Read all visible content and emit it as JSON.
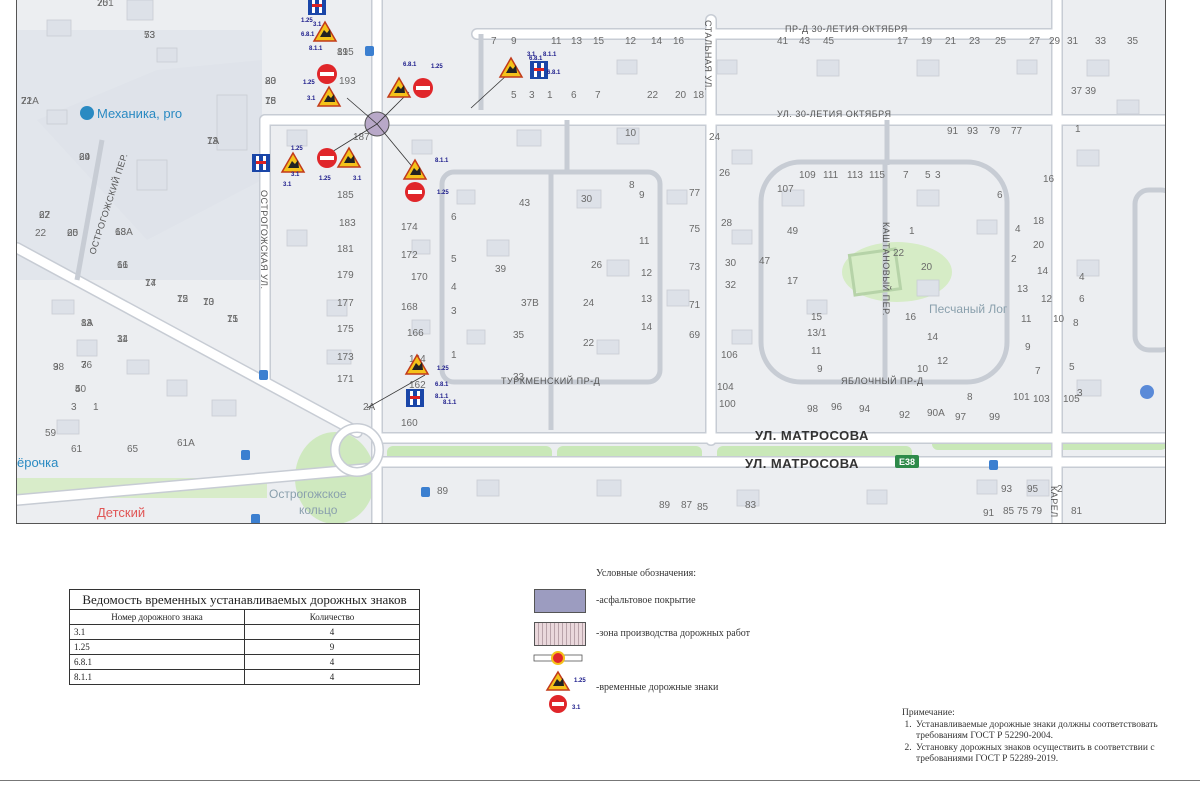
{
  "map": {
    "streets": {
      "prd_30": "ПР-Д 30-ЛЕТИЯ ОКТЯБРЯ",
      "ul_30": "УЛ. 30-ЛЕТИЯ ОКТЯБРЯ",
      "matrosova_1": "УЛ. МАТРОСОВА",
      "matrosova_2": "УЛ. МАТРОСОВА",
      "turkmen": "ТУРКМЕНСКИЙ ПР-Д",
      "yablochny": "ЯБЛОЧНЫЙ ПР-Д",
      "kashtanovy": "КАШТАНОВЫЙ ПЕР.",
      "ostrogozh_per": "ОСТРОГОЖСКИЙ ПЕР.",
      "ostrogozh_ul": "ОСТРОГОЖСКАЯ УЛ.",
      "vertical_ul": "СТАЛЬНАЯ УЛ.",
      "karel": "КАРЕЛ"
    },
    "pois": {
      "mechanika": "Механика, pro",
      "peschany": "Песчаный Лог",
      "ostrogozh_ring_1": "Острогожское",
      "ostrogozh_ring_2": "кольцо",
      "detsky": "Детский",
      "erochka": "ёрочка"
    },
    "route_badge": "E38",
    "house_numbers": [
      "201",
      "53",
      "195",
      "20",
      "18",
      "1А",
      "22А",
      "24",
      "22",
      "20",
      "18",
      "16",
      "14",
      "12",
      "10",
      "15",
      "13",
      "11",
      "7",
      "9",
      "5",
      "3",
      "1",
      "59",
      "61",
      "65",
      "61А",
      "22",
      "193",
      "187",
      "185",
      "183",
      "181",
      "179",
      "177",
      "175",
      "173",
      "171",
      "2А",
      "174",
      "172",
      "170",
      "168",
      "166",
      "164",
      "162",
      "160",
      "4",
      "5",
      "3",
      "1",
      "6",
      "43",
      "39",
      "37В",
      "35",
      "33",
      "30",
      "26",
      "24",
      "22",
      "10",
      "8",
      "9",
      "11",
      "12",
      "13",
      "14",
      "77",
      "75",
      "73",
      "71",
      "69",
      "7",
      "5",
      "3",
      "1",
      "6",
      "7",
      "9",
      "11",
      "13",
      "15",
      "12",
      "14",
      "16",
      "18",
      "20",
      "22",
      "24",
      "26",
      "28",
      "30",
      "32",
      "106",
      "104",
      "100",
      "98",
      "96",
      "94",
      "92",
      "90А",
      "97",
      "99",
      "101",
      "103",
      "105",
      "107",
      "109",
      "111",
      "113",
      "115",
      "17",
      "19",
      "21",
      "23",
      "25",
      "27",
      "29",
      "31",
      "33",
      "35",
      "37",
      "39",
      "41",
      "43",
      "45",
      "47",
      "49",
      "17",
      "15",
      "13/1",
      "11",
      "9",
      "7",
      "5",
      "3",
      "1",
      "22",
      "20",
      "16",
      "14",
      "12",
      "10",
      "8",
      "6",
      "4",
      "2",
      "13",
      "11",
      "9",
      "7",
      "5",
      "3",
      "1",
      "20",
      "18",
      "16",
      "14",
      "12",
      "10",
      "8",
      "6",
      "4",
      "2",
      "95",
      "93",
      "91",
      "89",
      "87",
      "85",
      "83",
      "81",
      "79",
      "75",
      "85",
      "89",
      "91",
      "93",
      "79",
      "77",
      "75",
      "73",
      "81",
      "83",
      "75",
      "73",
      "71",
      "69",
      "67",
      "65",
      "63А",
      "61",
      "77",
      "75",
      "73",
      "71",
      "8А",
      "34",
      "36",
      "38",
      "40"
    ],
    "sign_codes": [
      "1.25",
      "3.1",
      "6.8.1",
      "8.1.1",
      "1.25",
      "3.1",
      "6.8.1",
      "1.25",
      "3.1",
      "8.1.1",
      "6.8.1",
      "1.25",
      "3.1",
      "1.25",
      "3.1",
      "8.1.1",
      "1.25",
      "3.1",
      "6.8.1",
      "8.1.1",
      "1.25",
      "6.8.1",
      "8.1.1"
    ]
  },
  "ledger": {
    "title": "Ведомость временных устанавливаемых дорожных знаков",
    "col_sign": "Номер дорожного знака",
    "col_qty": "Количество",
    "rows": [
      {
        "sign": "3.1",
        "qty": "4"
      },
      {
        "sign": "1.25",
        "qty": "9"
      },
      {
        "sign": "6.8.1",
        "qty": "4"
      },
      {
        "sign": "8.1.1",
        "qty": "4"
      }
    ]
  },
  "legend": {
    "title": "Условные обозначения:",
    "asphalt": "-асфальтовое покрытие",
    "workzone": "-зона производства дорожных работ",
    "signs": "-временные дорожные знаки",
    "sign_label_1": "1.25",
    "sign_label_2": "3.1",
    "color_asphalt": "#9c9cc0"
  },
  "notes": {
    "title": "Примечание:",
    "items": [
      "Устанавливаемые дорожные знаки должны соответствовать требованиям ГОСТ Р 52290-2004.",
      "Установку дорожных знаков осуществить в соответствии с требованиями ГОСТ Р 52289-2019."
    ]
  }
}
